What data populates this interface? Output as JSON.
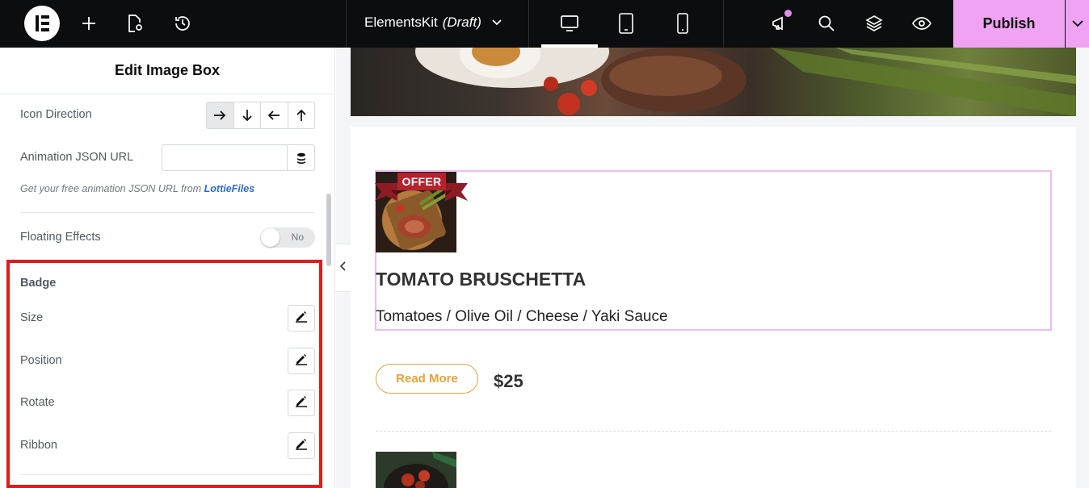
{
  "topbar": {
    "doc_title": "ElementsKit",
    "doc_status": "(Draft)",
    "publish_label": "Publish",
    "icons": {
      "add": "plus-icon",
      "page_settings": "page-settings-icon",
      "history": "history-icon",
      "desktop": "desktop-icon",
      "tablet": "tablet-icon",
      "mobile": "mobile-icon",
      "notifications": "megaphone-icon",
      "search": "search-icon",
      "structure": "layers-icon",
      "preview": "eye-icon"
    },
    "colors": {
      "bar": "#0c0d0e",
      "publish": "#efa3f2",
      "notification_dot": "#e28ee6"
    }
  },
  "panel": {
    "title": "Edit Image Box",
    "icon_direction_label": "Icon Direction",
    "animation_url_label": "Animation JSON URL",
    "animation_url_value": "",
    "help_prefix": "Get your free animation JSON URL from",
    "help_link": "LottieFiles",
    "floating_effects_label": "Floating Effects",
    "floating_effects_value": "No",
    "badge_section": "Badge",
    "badge_controls": [
      "Size",
      "Position",
      "Rotate",
      "Ribbon"
    ],
    "highlight_color": "#e01b1b"
  },
  "preview": {
    "badge_text": "OFFER",
    "title": "TOMATO BRUSCHETTA",
    "description": "Tomatoes / Olive Oil / Cheese / Yaki Sauce",
    "button_label": "Read More",
    "price": "$25",
    "colors": {
      "accent": "#e8a23a",
      "ribbon": "#b3242f",
      "selection": "#efbdf2"
    }
  }
}
